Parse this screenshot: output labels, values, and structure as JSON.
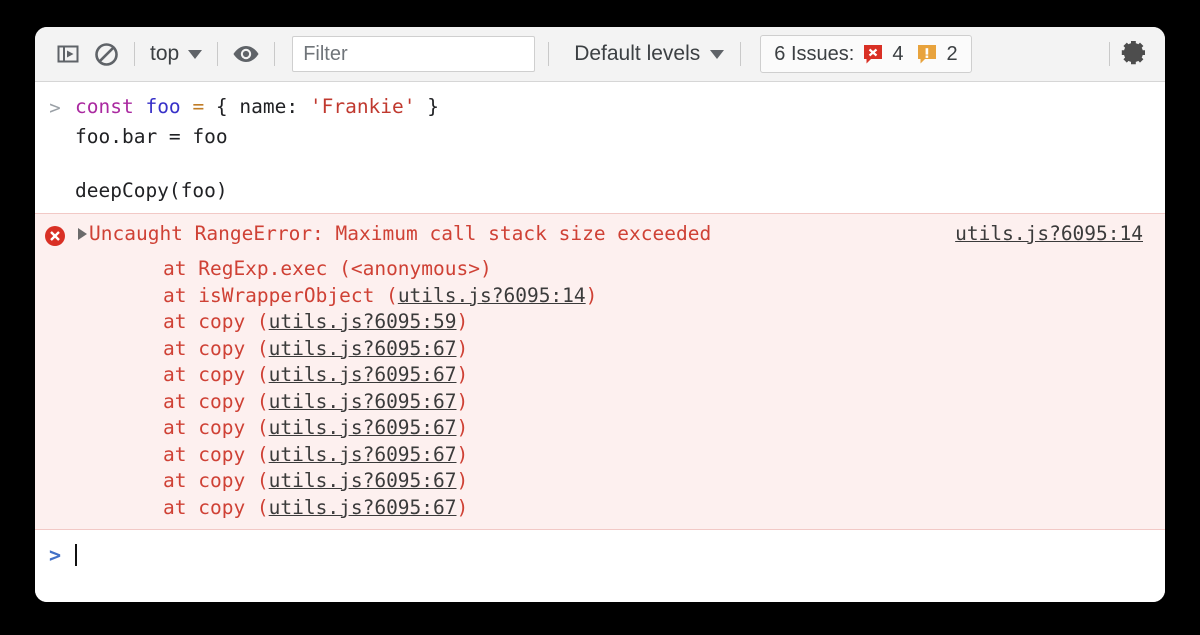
{
  "toolbar": {
    "sidebar_toggle_icon": "sidebar-panel-icon",
    "clear_console_icon": "clear-console-icon",
    "context_label": "top",
    "context_caret_icon": "chevron-down-icon",
    "live_expression_icon": "eye-icon",
    "filter_placeholder": "Filter",
    "filter_value": "",
    "levels_label": "Default levels",
    "levels_caret_icon": "chevron-down-icon",
    "issues_label": "6 Issues:",
    "error_badge_icon": "error-bubble-icon",
    "error_badge_count": "4",
    "warning_badge_icon": "warning-bubble-icon",
    "warning_badge_count": "2",
    "settings_icon": "gear-icon",
    "colors": {
      "error_badge": "#d93025",
      "warning_badge": "#e8a33d",
      "toolbar_bg": "#f3f3f3"
    }
  },
  "console": {
    "input_prompt_symbol": ">",
    "input_line_1": {
      "kw": "const",
      "space1": " ",
      "var": "foo",
      "space2": " ",
      "op": "=",
      "rest": " { name: ",
      "str": "'Frankie'",
      "tail": " }"
    },
    "input_line_2": "foo.bar = foo",
    "call_line": "deepCopy(foo)",
    "error": {
      "icon": "error-circle-icon",
      "disclosure_icon": "triangle-right-icon",
      "title": "Uncaught RangeError: Maximum call stack size exceeded",
      "source_link": "utils.js?6095:14",
      "stack": [
        {
          "prefix": "at RegExp.exec (",
          "link": "",
          "plain": "<anonymous>",
          "suffix": ")"
        },
        {
          "prefix": "at isWrapperObject (",
          "link": "utils.js?6095:14",
          "plain": "",
          "suffix": ")"
        },
        {
          "prefix": "at copy (",
          "link": "utils.js?6095:59",
          "plain": "",
          "suffix": ")"
        },
        {
          "prefix": "at copy (",
          "link": "utils.js?6095:67",
          "plain": "",
          "suffix": ")"
        },
        {
          "prefix": "at copy (",
          "link": "utils.js?6095:67",
          "plain": "",
          "suffix": ")"
        },
        {
          "prefix": "at copy (",
          "link": "utils.js?6095:67",
          "plain": "",
          "suffix": ")"
        },
        {
          "prefix": "at copy (",
          "link": "utils.js?6095:67",
          "plain": "",
          "suffix": ")"
        },
        {
          "prefix": "at copy (",
          "link": "utils.js?6095:67",
          "plain": "",
          "suffix": ")"
        },
        {
          "prefix": "at copy (",
          "link": "utils.js?6095:67",
          "plain": "",
          "suffix": ")"
        },
        {
          "prefix": "at copy (",
          "link": "utils.js?6095:67",
          "plain": "",
          "suffix": ")"
        }
      ],
      "colors": {
        "background": "#fdf0ef",
        "border": "#f2c9c6",
        "text": "#cf4135",
        "link": "#3b3b3b"
      }
    },
    "bottom_prompt_symbol": ">",
    "bottom_prompt_value": ""
  }
}
